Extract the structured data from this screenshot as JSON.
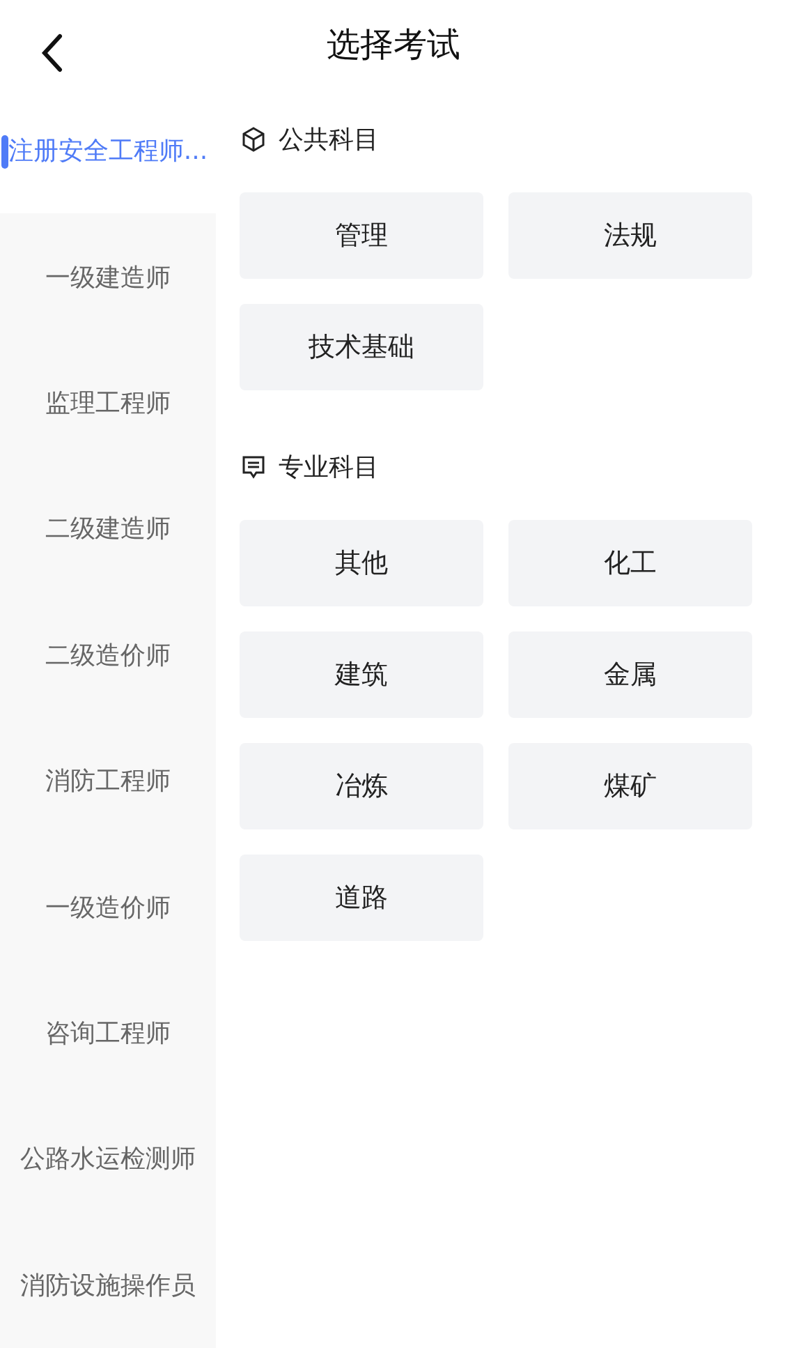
{
  "header": {
    "title": "选择考试"
  },
  "sidebar": {
    "items": [
      {
        "label": "注册安全工程师...",
        "selected": true
      },
      {
        "label": "一级建造师",
        "selected": false
      },
      {
        "label": "监理工程师",
        "selected": false
      },
      {
        "label": "二级建造师",
        "selected": false
      },
      {
        "label": "二级造价师",
        "selected": false
      },
      {
        "label": "消防工程师",
        "selected": false
      },
      {
        "label": "一级造价师",
        "selected": false
      },
      {
        "label": "咨询工程师",
        "selected": false
      },
      {
        "label": "公路水运检测师",
        "selected": false
      },
      {
        "label": "消防设施操作员",
        "selected": false
      }
    ]
  },
  "sections": [
    {
      "kind": "public",
      "title": "公共科目",
      "subjects": [
        "管理",
        "法规",
        "技术基础"
      ]
    },
    {
      "kind": "major",
      "title": "专业科目",
      "subjects": [
        "其他",
        "化工",
        "建筑",
        "金属",
        "冶炼",
        "煤矿",
        "道路"
      ]
    }
  ]
}
